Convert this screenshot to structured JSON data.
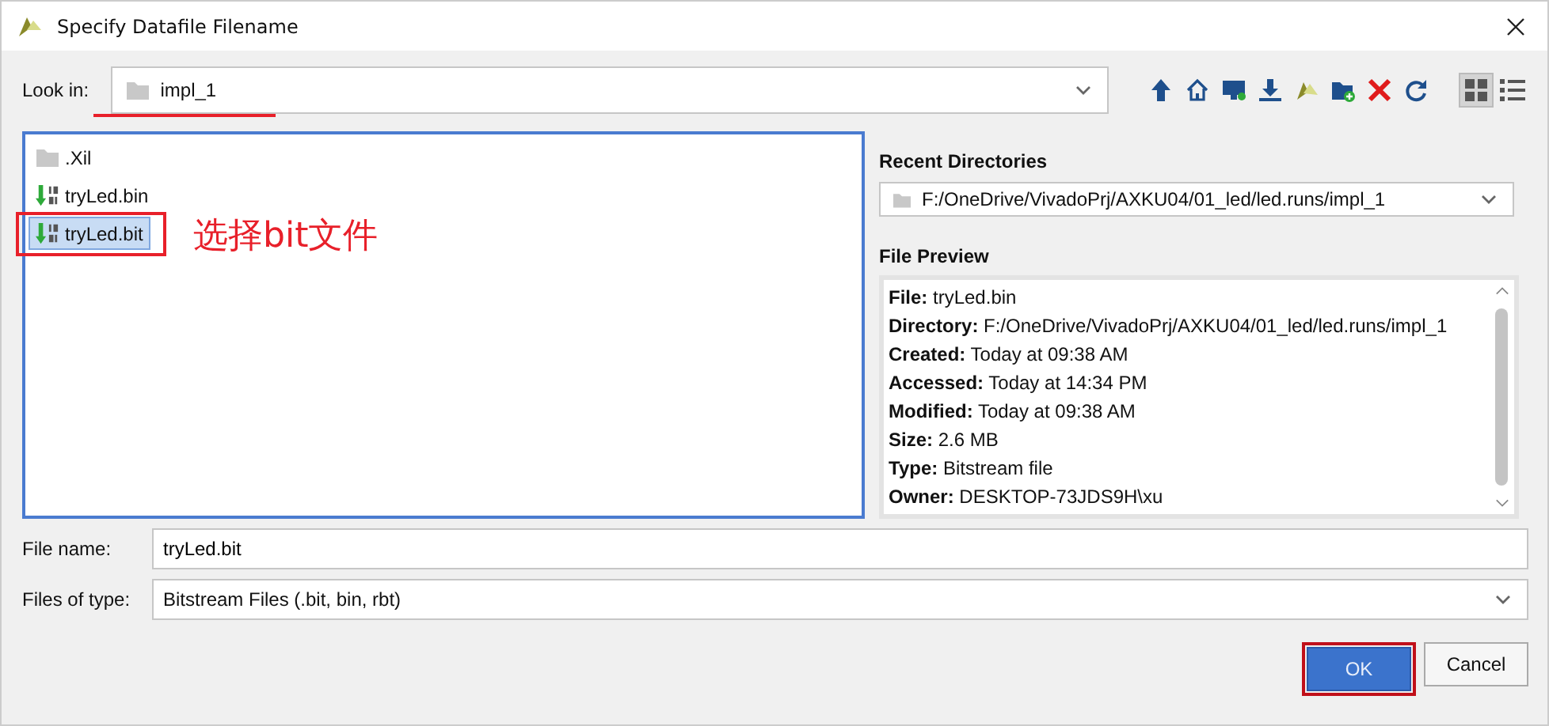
{
  "window": {
    "title": "Specify Datafile Filename"
  },
  "look_in": {
    "label": "Look in:",
    "value": "impl_1"
  },
  "view_modes": [
    {
      "kind": "grid",
      "selected": true
    },
    {
      "kind": "list",
      "selected": false
    }
  ],
  "files": [
    {
      "name": ".Xil",
      "kind": "folder",
      "selected": false
    },
    {
      "name": "tryLed.bin",
      "kind": "bitstream",
      "selected": false
    },
    {
      "name": "tryLed.bit",
      "kind": "bitstream",
      "selected": true
    }
  ],
  "annotation": {
    "text": "选择bit文件"
  },
  "recent_directories": {
    "label": "Recent Directories",
    "value": "F:/OneDrive/VivadoPrj/AXKU04/01_led/led.runs/impl_1"
  },
  "file_preview": {
    "label": "File Preview",
    "lines": [
      "**File:** tryLed.bin",
      "**Directory:** F:/OneDrive/VivadoPrj/AXKU04/01_led/led.runs/impl_1",
      "**Created:** Today at 09:38 AM",
      "**Accessed:** Today at 14:34 PM",
      "**Modified:** Today at 09:38 AM",
      "**Size:** 2.6 MB",
      "**Type:** Bitstream file",
      "**Owner:** DESKTOP-73JDS9H\\xu"
    ]
  },
  "file_name": {
    "label": "File name:",
    "value": "tryLed.bit"
  },
  "files_of_type": {
    "label": "Files of type:",
    "value": "Bitstream Files (.bit, bin, rbt)"
  },
  "buttons": [
    {
      "label": "OK",
      "kind": "primary"
    },
    {
      "label": "Cancel",
      "kind": "secondary"
    }
  ]
}
